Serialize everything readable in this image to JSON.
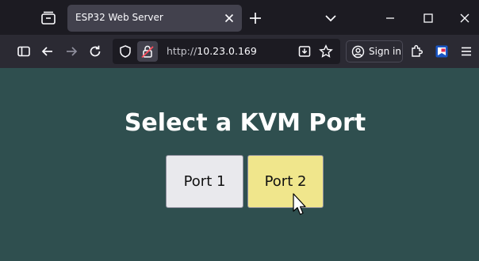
{
  "browser": {
    "tab": {
      "title": "ESP32 Web Server"
    },
    "urlbar": {
      "scheme": "http://",
      "host": "10.23.0.169"
    },
    "signin_label": "Sign in",
    "icons": {
      "tab_list": "tab-list-icon",
      "tab_close": "close-icon",
      "new_tab": "plus-icon",
      "list_all_tabs": "chevron-down-icon",
      "minimize": "minimize-icon",
      "maximize": "maximize-icon",
      "close_window": "close-icon",
      "sidebar": "sidebar-icon",
      "back": "back-arrow-icon",
      "forward": "forward-arrow-icon",
      "reload": "reload-icon",
      "shield": "shield-icon",
      "insecure_lock": "insecure-lock-icon",
      "save_to_pocket": "download-icon",
      "bookmark": "star-icon",
      "account": "account-icon",
      "extensions": "extensions-icon",
      "extension": "extension-icon",
      "menu": "hamburger-menu-icon"
    }
  },
  "page": {
    "title": "Select a KVM Port",
    "ports": [
      {
        "label": "Port 1",
        "color": "#e9e9ed"
      },
      {
        "label": "Port 2",
        "color": "#f0e68c"
      }
    ],
    "background_color": "#2f4f4f"
  }
}
